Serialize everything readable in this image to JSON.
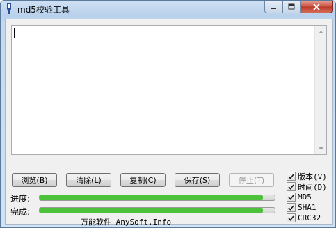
{
  "window": {
    "title": "md5校验工具"
  },
  "icons": {
    "app": "key-icon",
    "minimize": "minimize-icon",
    "maximize": "maximize-icon",
    "close": "close-icon"
  },
  "buttons": {
    "browse": "浏览(B)",
    "clear": "清除(L)",
    "copy": "复制(C)",
    "save": "保存(S)",
    "stop": "停止(T)"
  },
  "progress": {
    "label": "进度:",
    "value": 0.95
  },
  "complete": {
    "label": "完成:",
    "value": 0.95
  },
  "checkboxes": [
    {
      "label": "版本(V)",
      "checked": true
    },
    {
      "label": "时间(D)",
      "checked": true
    },
    {
      "label": "MD5",
      "checked": true
    },
    {
      "label": "SHA1",
      "checked": true
    },
    {
      "label": "CRC32",
      "checked": true
    }
  ],
  "footer": "万能软件 AnySoft.Info",
  "colors": {
    "progress_fill": "#4cc23a",
    "close_button": "#c8503e"
  }
}
